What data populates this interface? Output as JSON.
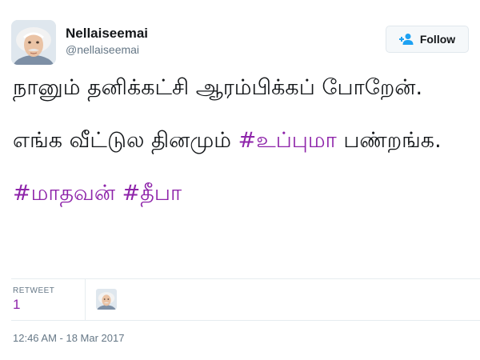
{
  "user": {
    "display_name": "Nellaiseemai",
    "screen_name": "@nellaiseemai",
    "avatar_icon": "avatar-portrait-icon"
  },
  "follow": {
    "label": "Follow",
    "icon": "add-person-icon",
    "accent_color": "#1da1f2"
  },
  "tweet": {
    "line1": "நானும் தனிக்கட்சி ஆரம்பிக்கப் போறேன்.",
    "line2_text": "எங்க வீட்டுல தினமும் ",
    "line2_hashtag": "#உப்புமா",
    "line2_tail": " பண்றங்க.",
    "hashtag_1": "#மாதவன்",
    "hashtag_2": "#தீபா",
    "hashtag_color": "#8e24aa"
  },
  "stats": {
    "retweet_label": "RETWEET",
    "retweet_count": "1"
  },
  "timestamp": "12:46 AM - 18 Mar 2017"
}
